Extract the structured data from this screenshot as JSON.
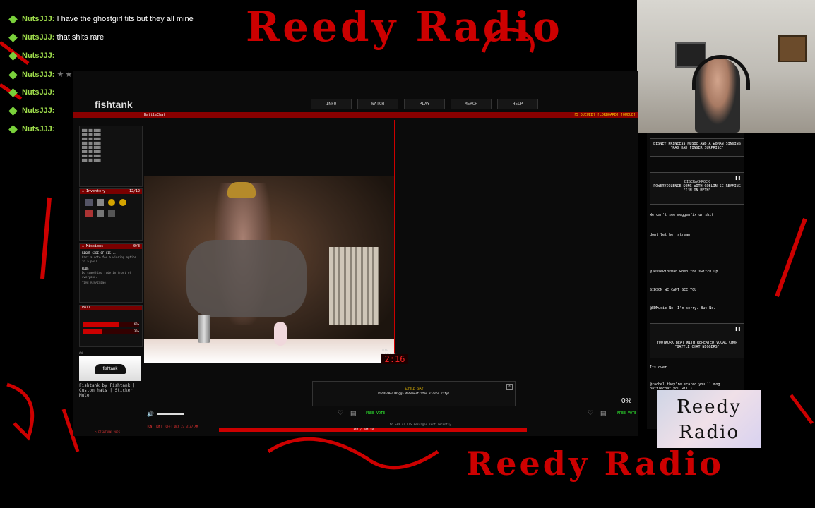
{
  "overlay_title": "Reedy Radio",
  "overlay_bottom_title": "Reedy Radio",
  "logo_text": "Reedy Radio",
  "chat_overlay": [
    {
      "user": "NutsJJJ:",
      "msg": "I have the ghostgirl tits but they all mine"
    },
    {
      "user": "NutsJJJ:",
      "msg": "that shits rare"
    },
    {
      "user": "NutsJJJ:",
      "msg": ""
    },
    {
      "user": "NutsJJJ:",
      "msg": ""
    },
    {
      "user": "NutsJJJ:",
      "msg": ""
    },
    {
      "user": "NutsJJJ:",
      "msg": ""
    },
    {
      "user": "NutsJJJ:",
      "msg": ""
    }
  ],
  "site": {
    "logo": "fishtank",
    "nav": [
      "INFO",
      "WATCH",
      "PLAY",
      "MERCH",
      "HELP"
    ],
    "battle_chat_label": "BattleChat",
    "queue_text": "[5 QUEUED] [LDRBOARD] [QUEUE]"
  },
  "sidebar": {
    "inventory_title": "Inventory",
    "inventory_count": "12/12",
    "missions_title": "Missions",
    "missions_count": "0/3",
    "mission1": "RIGHT SIDE OF HIS...",
    "mission1_desc": "Cast a vote for a winning option in a poll.",
    "mission2": "RUDE",
    "mission2_desc": "Do something rude in front of everyone.",
    "time_remaining": "TIME REMAINING",
    "poll_title": "Poll",
    "poll_yes_pct": "65%",
    "poll_no_pct": "35%",
    "ad_label": "Ad",
    "ad_brand": "fishtank",
    "ad_text": "Fishtank by Fishtank | Custom hats | Sticker Mule",
    "footer_copyright": "© FISHTANK 2025"
  },
  "video": {
    "timer": "2:16",
    "timer_label": "TIME REMAINING"
  },
  "battle_popup": {
    "title": "BATTLE CHAT",
    "message": "RadDadRealNigga defenestrated sidson.city!"
  },
  "controls": {
    "free_vote": "FREE VOTE",
    "free_vote_right": "FREE VOTE",
    "percent": "0%",
    "status_line": "No SFX or TTS messages sent recently.",
    "xp_line": "344 / 344 XP",
    "toggle_labels": [
      "ON",
      "ON",
      "OFF"
    ],
    "day_label": "DAY 27",
    "clock": "3:37 AM"
  },
  "right_chat": {
    "card1_title": "DISNEY PRINCESS MUSIC AND A WOMAN SINGING \"RAD DAD FINGER SURPRISE\"",
    "card2_user": "BIGCRACKROCK",
    "card2_title": "POWERVIOLENCE SONG WITH GOBLIN SC REAMING \"I'M ON METH\"",
    "msg1": "We can't see meggenfix ur shit",
    "msg2": "dont let her stream",
    "msg3": "@JessePinkman when the switch up",
    "msg4": "SIDSON WE CANT SEE YOU",
    "msg5": "@EDMusic No. I'm sorry. But No.",
    "card3_title": "FOOTWORK BEAT WITH REPEATED VOCAL CHOP \"BATTLE CHAT NIGGERS\"",
    "msg6": "Its over",
    "msg7": "@rachel they're scared you'll mog battlechat(you will)"
  },
  "colors": {
    "accent_red": "#c00000",
    "chat_green": "#7ad13b"
  }
}
